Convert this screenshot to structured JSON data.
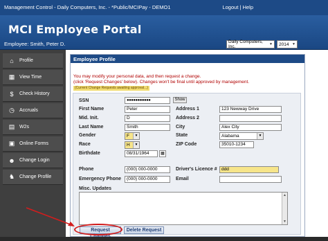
{
  "topbar": {
    "title": "Management Control - Daily Computers, Inc. - *Public/MCIPay - DEMO1",
    "logout": "Logout",
    "separator": "|",
    "help": "Help"
  },
  "banner": {
    "portal_title": "MCI Employee Portal",
    "employee": "Employee: Smith, Peter D.",
    "company_select": "Daily Computers, Inc.",
    "year_select": "2014"
  },
  "sidebar": {
    "items": [
      {
        "label": "Profile",
        "icon": "home-icon"
      },
      {
        "label": "View Time",
        "icon": "calendar-icon"
      },
      {
        "label": "Check History",
        "icon": "money-bag-icon"
      },
      {
        "label": "Accruals",
        "icon": "clock-icon"
      },
      {
        "label": "W2s",
        "icon": "document-icon"
      },
      {
        "label": "Online Forms",
        "icon": "forms-icon"
      },
      {
        "label": "Change Login",
        "icon": "person-icon"
      },
      {
        "label": "Change Profile",
        "icon": "profile-icon"
      }
    ]
  },
  "profile": {
    "heading": "Employee Profile",
    "message_line1": "You may modify your personal data, and then request a change.",
    "message_line2": "(click 'Request Changes' below). Changes won't be final until approved by management.",
    "pending_label": "(Current Change Requests awaiting approval...)",
    "labels": {
      "ssn": "SSN",
      "first_name": "First Name",
      "mid_init": "Mid. Init.",
      "last_name": "Last Name",
      "gender": "Gender",
      "race": "Race",
      "birthdate": "Birthdate",
      "address1": "Address 1",
      "address2": "Address 2",
      "city": "City",
      "state": "State",
      "zip": "ZIP Code",
      "phone": "Phone",
      "emergency_phone": "Emergency Phone",
      "drivers_license": "Driver's Licence #",
      "email": "Email",
      "misc_updates": "Misc. Updates"
    },
    "values": {
      "ssn": "●●●●●●●●●●●",
      "first_name": "Peter",
      "mid_init": "D",
      "last_name": "Smith",
      "gender": "F",
      "race": "H",
      "birthdate": "08/31/1964",
      "address1": "123 Newway Drive",
      "address2": "",
      "city": "Alex City",
      "state": "Alabama",
      "zip": "35010-1234",
      "phone": "(000) 000-0000",
      "emergency_phone": "(000) 000-0000",
      "drivers_license": "ddd",
      "email": "",
      "misc_updates": ""
    },
    "show_button": "Show",
    "calendar_icon": "calendar-icon",
    "request_button": "Request Changes",
    "delete_button": "Delete Request"
  },
  "colors": {
    "topbar": "#1d4a86",
    "sidebar": "#3f3f3f",
    "message": "#b00000",
    "highlight": "#f7e58a",
    "annotation": "#d21d1d"
  }
}
